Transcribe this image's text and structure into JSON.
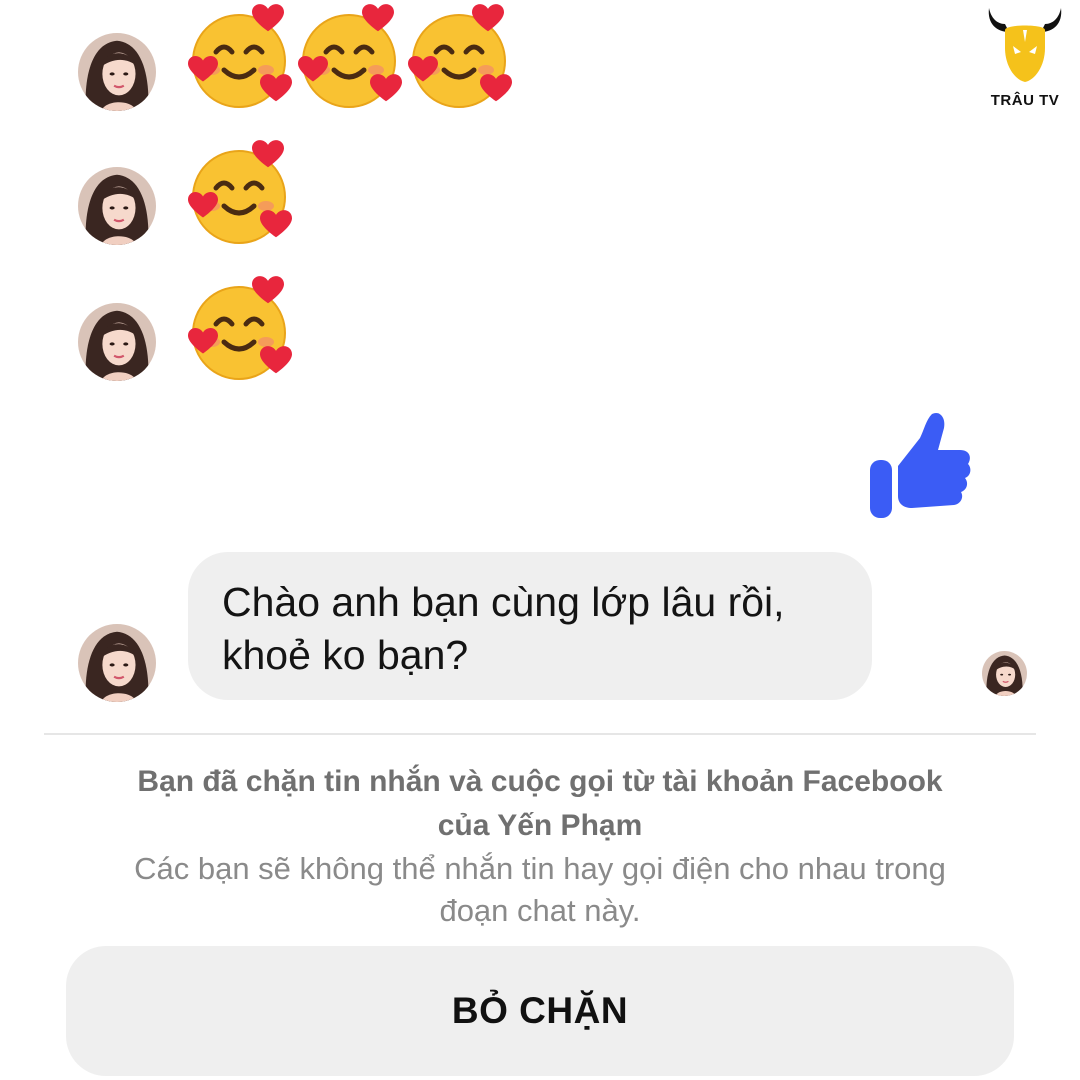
{
  "logo": {
    "text": "TRÂU TV",
    "icon": "bull-head-logo-icon",
    "color": "#f5c21b"
  },
  "contact": {
    "name": "Yến Phạm",
    "avatar_icon": "profile-photo"
  },
  "messages": {
    "emoji_rows": [
      {
        "emoji": "smiling-face-with-hearts",
        "count": 3
      },
      {
        "emoji": "smiling-face-with-hearts",
        "count": 1
      },
      {
        "emoji": "smiling-face-with-hearts",
        "count": 1
      }
    ],
    "sent_like_icon": "thumbs-up-icon",
    "like_color": "#3b5cf5",
    "text_message": {
      "line1": "Chào anh bạn cùng lớp lâu rồi,",
      "line2": "khoẻ ko bạn?"
    }
  },
  "block_notice": {
    "title_line1": "Bạn đã chặn tin nhắn và cuộc gọi từ tài khoản Facebook",
    "title_line2": "của Yến Phạm",
    "desc_line1": "Các bạn sẽ không thể nhắn tin hay gọi điện cho nhau trong",
    "desc_line2": "đoạn chat này."
  },
  "unblock_button": {
    "label": "BỎ CHẶN"
  }
}
